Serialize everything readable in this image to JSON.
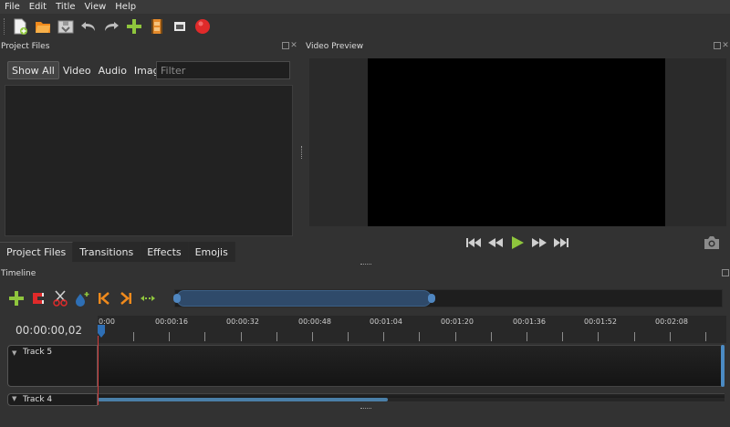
{
  "menu": [
    "File",
    "Edit",
    "Title",
    "View",
    "Help"
  ],
  "toolbar": {
    "icons": [
      "new-project-icon",
      "open-project-icon",
      "save-project-icon",
      "undo-icon",
      "redo-icon",
      "import-files-icon",
      "choose-profile-icon",
      "fullscreen-icon",
      "export-video-icon"
    ]
  },
  "project_files": {
    "title": "Project Files",
    "filters": [
      "Show All",
      "Video",
      "Audio",
      "Image"
    ],
    "active_filter": "Show All",
    "filter_placeholder": "Filter",
    "tabs": [
      "Project Files",
      "Transitions",
      "Effects",
      "Emojis"
    ],
    "active_tab": "Project Files"
  },
  "video_preview": {
    "title": "Video Preview"
  },
  "timeline": {
    "title": "Timeline",
    "timecode": "00:00:00,02",
    "ruler_labels": [
      "0:00",
      "00:00:16",
      "00:00:32",
      "00:00:48",
      "00:01:04",
      "00:01:20",
      "00:01:36",
      "00:01:52",
      "00:02:08"
    ],
    "tracks": [
      "Track 5",
      "Track 4"
    ]
  },
  "colors": {
    "accent_green": "#8fc63d",
    "record_red": "#e02a2a",
    "orange": "#f08a1c",
    "selection_blue": "#4f86c0"
  }
}
